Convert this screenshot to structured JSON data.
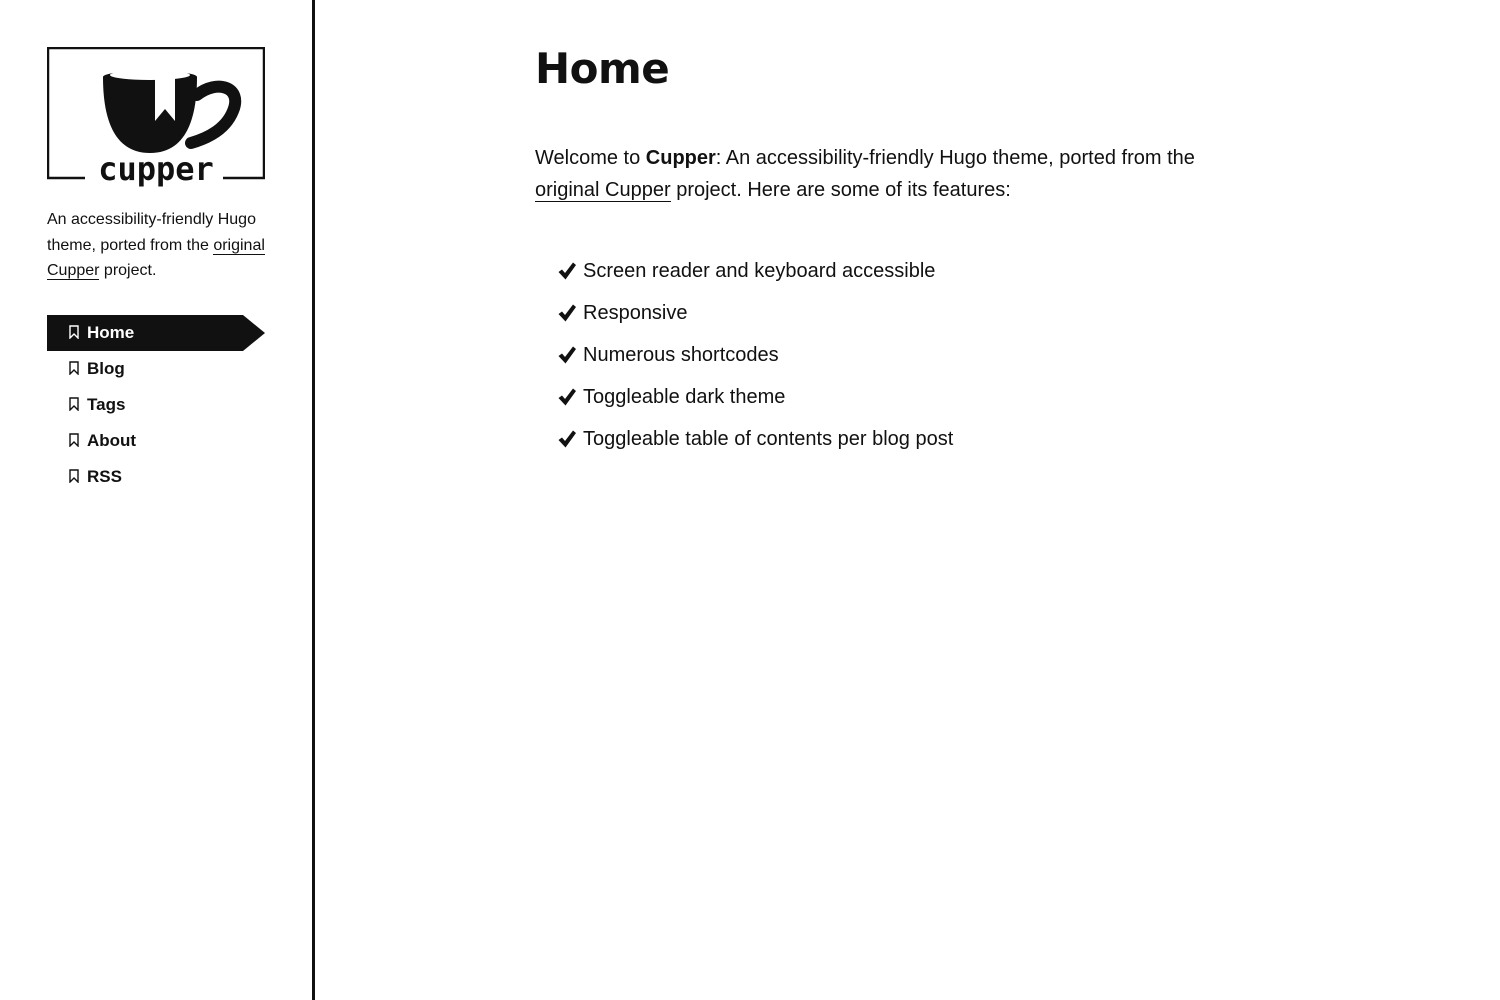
{
  "sidebar": {
    "logo_text": "cupper",
    "tagline": {
      "before": "An accessibility-friendly Hugo theme, ported from the ",
      "link": "original Cupper",
      "after": " project."
    },
    "menu": [
      {
        "label": "Home",
        "current": true
      },
      {
        "label": "Blog",
        "current": false
      },
      {
        "label": "Tags",
        "current": false
      },
      {
        "label": "About",
        "current": false
      },
      {
        "label": "RSS",
        "current": false
      }
    ]
  },
  "main": {
    "title": "Home",
    "intro": {
      "welcome": "Welcome to ",
      "brand": "Cupper",
      "rest": ": An accessibility-friendly Hugo theme, ported from the ",
      "link": "original Cupper",
      "after": " project. Here are some of its features:"
    },
    "features": [
      "Screen reader and keyboard accessible",
      "Responsive",
      "Numerous shortcodes",
      "Toggleable dark theme",
      "Toggleable table of contents per blog post"
    ]
  },
  "colors": {
    "foreground": "#111111",
    "background": "#ffffff"
  },
  "icons": {
    "logo": "cup-with-bookmark-icon",
    "menu_item": "bookmark-icon",
    "feature": "checkmark-icon"
  }
}
